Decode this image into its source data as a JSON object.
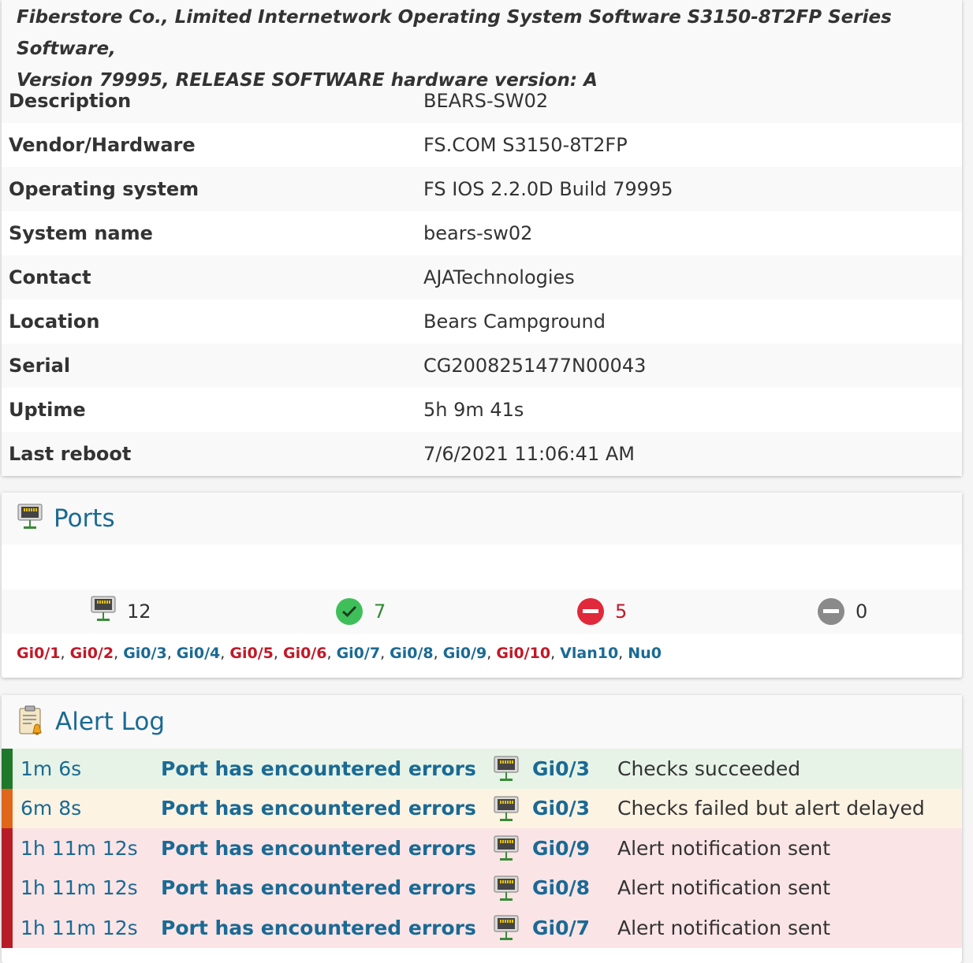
{
  "overview": {
    "sys_descr_line1": "Fiberstore Co., Limited Internetwork Operating System Software S3150-8T2FP Series Software,",
    "sys_descr_line2": "Version 79995, RELEASE SOFTWARE hardware version: A",
    "rows": [
      {
        "key": "Description",
        "value": "BEARS-SW02"
      },
      {
        "key": "Vendor/Hardware",
        "value": "FS.COM S3150-8T2FP"
      },
      {
        "key": "Operating system",
        "value": "FS IOS 2.2.0D Build 79995"
      },
      {
        "key": "System name",
        "value": "bears-sw02"
      },
      {
        "key": "Contact",
        "value": "AJATechnologies"
      },
      {
        "key": "Location",
        "value": "Bears Campground"
      },
      {
        "key": "Serial",
        "value": "CG2008251477N00043"
      },
      {
        "key": "Uptime",
        "value": "5h 9m 41s"
      },
      {
        "key": "Last reboot",
        "value": "7/6/2021 11:06:41 AM"
      }
    ]
  },
  "ports": {
    "title": "Ports",
    "counts": {
      "total": "12",
      "up": "7",
      "down": "5",
      "disabled": "0"
    },
    "list": [
      {
        "name": "Gi0/1",
        "state": "down"
      },
      {
        "name": "Gi0/2",
        "state": "down"
      },
      {
        "name": "Gi0/3",
        "state": "up"
      },
      {
        "name": "Gi0/4",
        "state": "up"
      },
      {
        "name": "Gi0/5",
        "state": "down"
      },
      {
        "name": "Gi0/6",
        "state": "down"
      },
      {
        "name": "Gi0/7",
        "state": "up"
      },
      {
        "name": "Gi0/8",
        "state": "up"
      },
      {
        "name": "Gi0/9",
        "state": "up"
      },
      {
        "name": "Gi0/10",
        "state": "down"
      },
      {
        "name": "Vlan10",
        "state": "up"
      },
      {
        "name": "Nu0",
        "state": "up"
      }
    ]
  },
  "alert_log": {
    "title": "Alert Log",
    "entries": [
      {
        "time": "1m 6s",
        "rule": "Port has encountered errors",
        "port": "Gi0/3",
        "status": "Checks succeeded",
        "severity": "ok"
      },
      {
        "time": "6m 8s",
        "rule": "Port has encountered errors",
        "port": "Gi0/3",
        "status": "Checks failed but alert delayed",
        "severity": "warn"
      },
      {
        "time": "1h 11m 12s",
        "rule": "Port has encountered errors",
        "port": "Gi0/9",
        "status": "Alert notification sent",
        "severity": "crit"
      },
      {
        "time": "1h 11m 12s",
        "rule": "Port has encountered errors",
        "port": "Gi0/8",
        "status": "Alert notification sent",
        "severity": "crit"
      },
      {
        "time": "1h 11m 12s",
        "rule": "Port has encountered errors",
        "port": "Gi0/7",
        "status": "Alert notification sent",
        "severity": "crit"
      }
    ]
  },
  "colors": {
    "link": "#1a6a94",
    "down": "#c21827",
    "ok": "#3fbf5a",
    "crit": "#b81d27",
    "warn": "#e0661a"
  },
  "icons": {
    "port": "ethernet-port-icon",
    "alert_log": "clipboard-alert-icon",
    "up": "check-circle-icon",
    "down": "minus-circle-red-icon",
    "disabled": "minus-circle-grey-icon"
  }
}
